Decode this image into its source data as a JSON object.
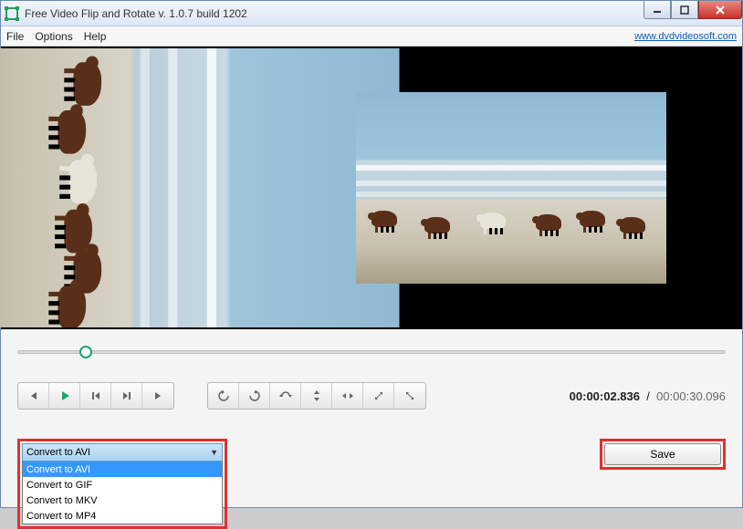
{
  "titlebar": {
    "title": "Free Video Flip and Rotate v. 1.0.7 build 1202"
  },
  "menu": {
    "file": "File",
    "options": "Options",
    "help": "Help",
    "link": "www.dvdvideosoft.com"
  },
  "slider": {
    "position_pct": 9.5
  },
  "time": {
    "current": "00:00:02.836",
    "separator": "/",
    "total": "00:00:30.096"
  },
  "format": {
    "selected": "Convert to AVI",
    "options": [
      "Convert to AVI",
      "Convert to GIF",
      "Convert to MKV",
      "Convert to MP4"
    ]
  },
  "save": {
    "label": "Save"
  }
}
